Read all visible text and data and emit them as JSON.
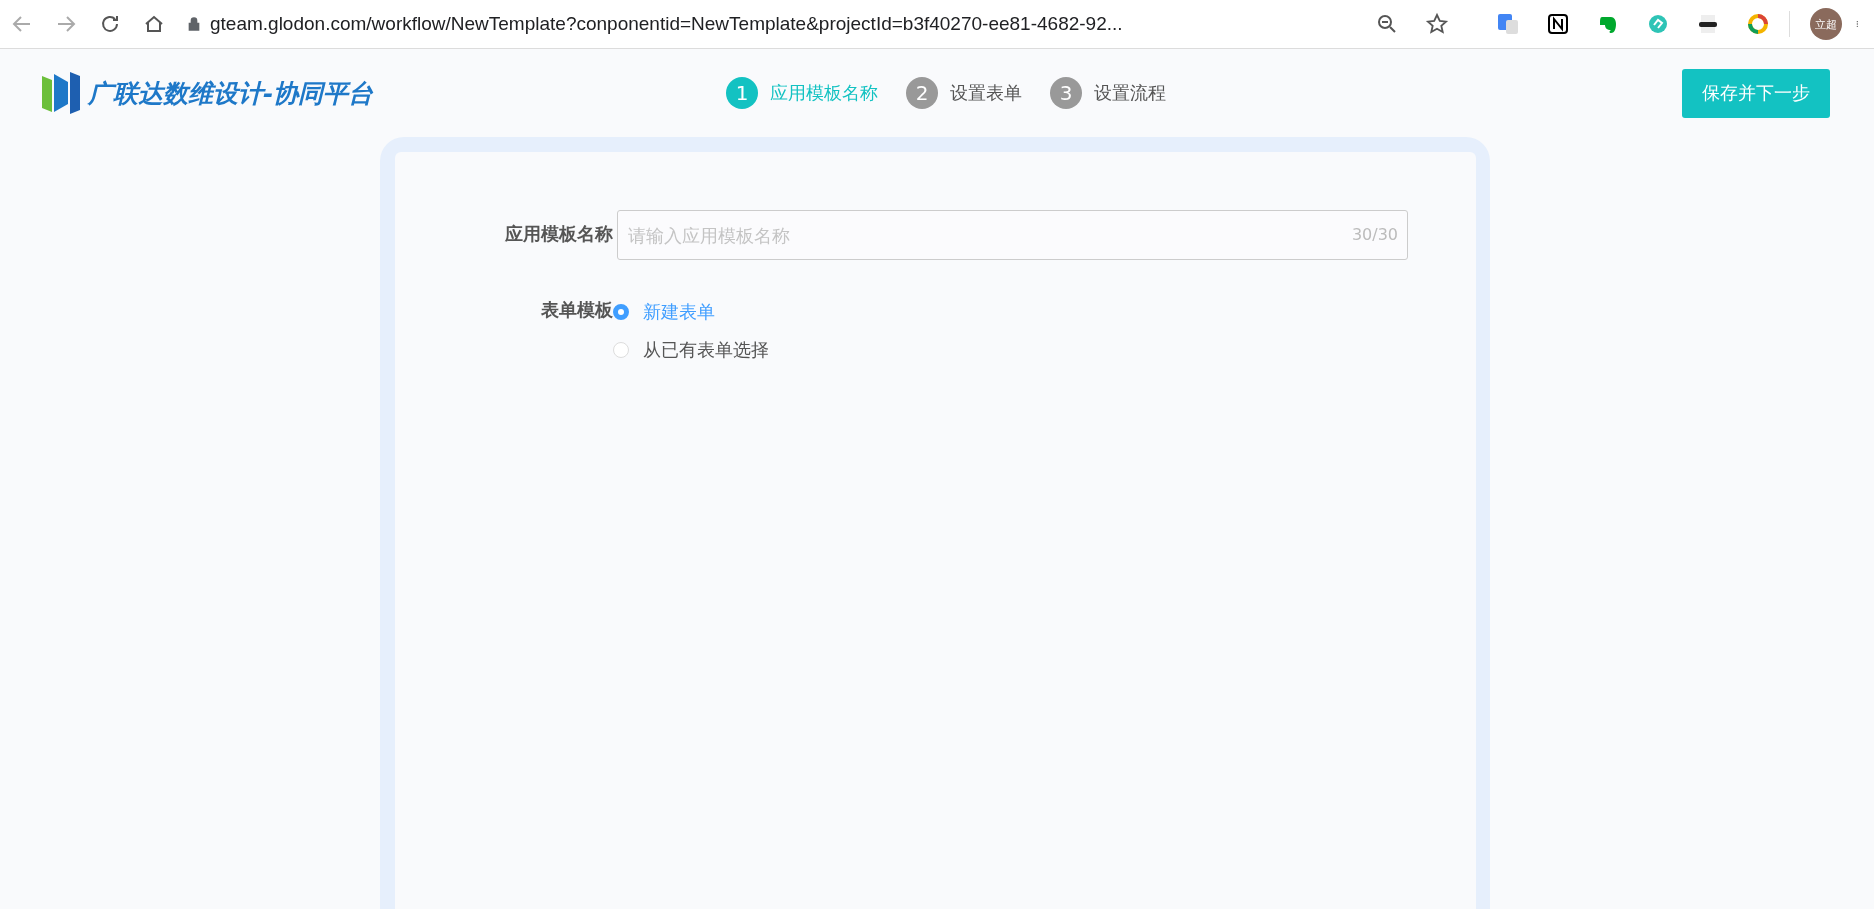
{
  "browser": {
    "url": "gteam.glodon.com/workflow/NewTemplate?conponentid=NewTemplate&projectId=b3f40270-ee81-4682-92...",
    "avatar": "立超"
  },
  "header": {
    "logo": "广联达数维设计-协同平台",
    "steps": [
      {
        "number": "1",
        "label": "应用模板名称",
        "selected": true
      },
      {
        "number": "2",
        "label": "设置表单",
        "selected": false
      },
      {
        "number": "3",
        "label": "设置流程",
        "selected": false
      }
    ],
    "save_button": "保存并下一步"
  },
  "form": {
    "name_field": {
      "label": "应用模板名称",
      "placeholder": "请输入应用模板名称",
      "count": "30/30"
    },
    "template": {
      "label": "表单模板",
      "options": [
        {
          "label": "新建表单",
          "selected": true
        },
        {
          "label": "从已有表单选择",
          "selected": false
        }
      ]
    }
  }
}
